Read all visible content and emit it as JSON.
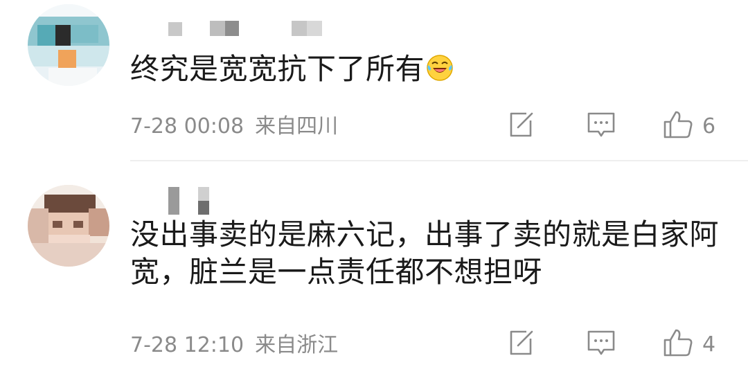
{
  "comments": [
    {
      "text": "终究是宽宽抗下了所有",
      "emoji": "laughing-crying-emoji",
      "time": "7-28 00:08",
      "location": "来自四川",
      "likes": "6"
    },
    {
      "text": "没出事卖的是麻六记，出事了卖的就是白家阿宽，脏兰是一点责任都不想担呀",
      "time": "7-28 12:10",
      "location": "来自浙江",
      "likes": "4"
    }
  ],
  "icons": {
    "share": "share-icon",
    "comment": "comment-icon",
    "like": "thumbs-up-icon"
  },
  "colors": {
    "text": "#1a1a1a",
    "meta": "#8a8a8a",
    "divider": "#eeeeee"
  }
}
